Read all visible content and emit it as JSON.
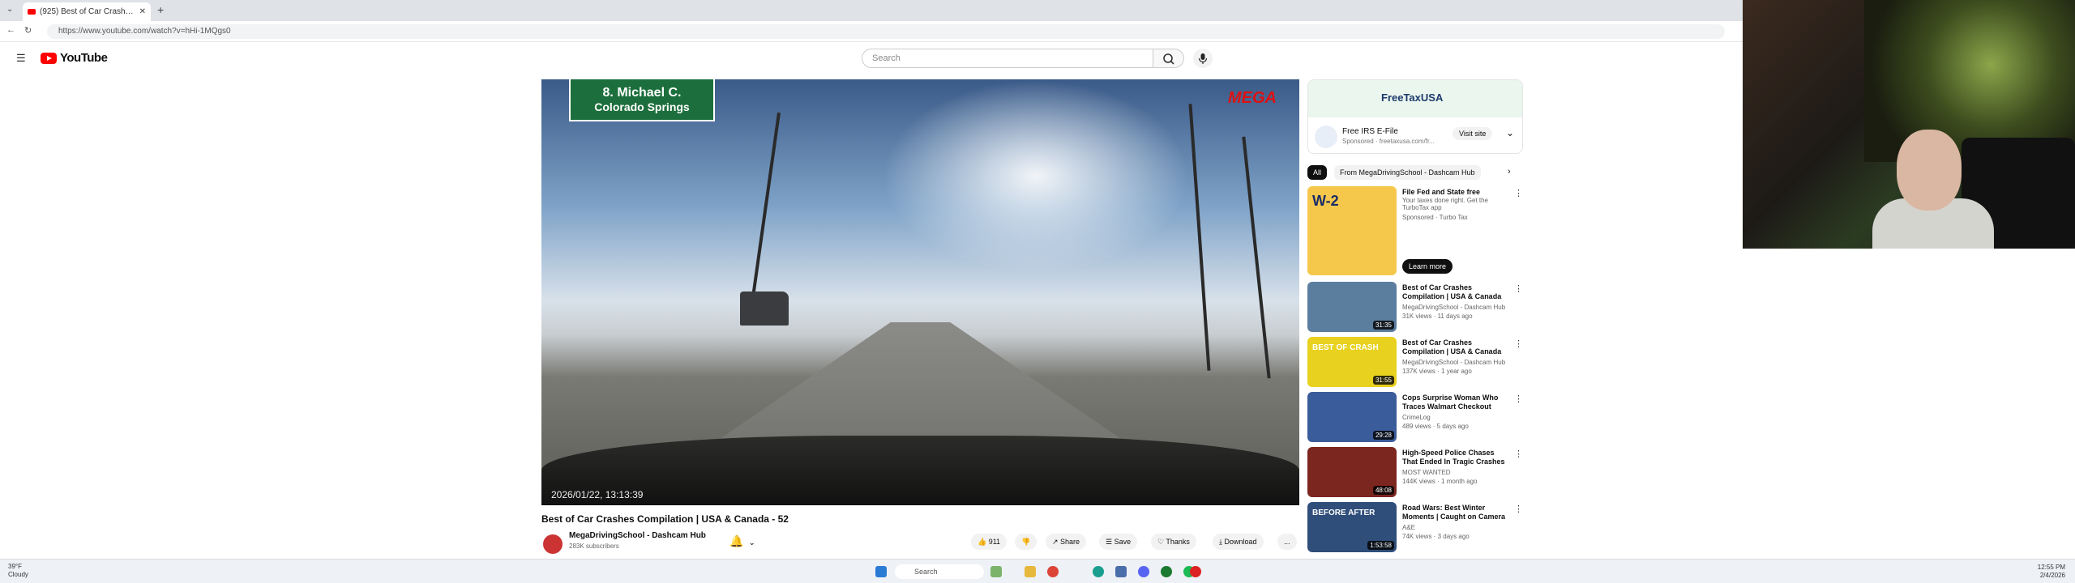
{
  "browser": {
    "tab_title": "(925) Best of Car Crashes Co",
    "url": "https://www.youtube.com/watch?v=hHi-1MQgs0"
  },
  "header": {
    "logo": "YouTube",
    "search_placeholder": "Search"
  },
  "video": {
    "sign_line1": "8. Michael C.",
    "sign_line2": "Colorado Springs",
    "watermark": "MEGA",
    "timestamp": "2026/01/22, 13:13:39",
    "title": "Best of Car Crashes Compilation | USA & Canada - 52",
    "channel": "MegaDrivingSchool - Dashcam Hub",
    "subscribers": "283K subscribers",
    "likes": "911",
    "actions": {
      "share": "Share",
      "save": "Save",
      "thanks": "Thanks",
      "download": "Download",
      "more": "..."
    }
  },
  "ad": {
    "brand": "FreeTaxUSA",
    "title": "Free IRS E-File",
    "sponsor": "Sponsored · freetaxusa.com/fr...",
    "visit": "Visit site"
  },
  "chips": [
    {
      "label": "All",
      "active": true
    },
    {
      "label": "From MegaDrivingSchool - Dashcam Hub",
      "active": false
    }
  ],
  "sidebar": [
    {
      "title": "File Fed and State free",
      "channel": "Your taxes done right. Get the TurboTax app",
      "meta": "Sponsored · Turbo Tax",
      "duration": "",
      "thumb_color": "#f5c84c",
      "thumb_text": "W-2",
      "cta": "Learn more"
    },
    {
      "title": "Best of Car Crashes Compilation | USA & Canada -...",
      "channel": "MegaDrivingSchool - Dashcam Hub",
      "meta": "31K views · 11 days ago",
      "duration": "31:35",
      "thumb_color": "#5b7e9f",
      "thumb_text": "",
      "cta": ""
    },
    {
      "title": "Best of Car Crashes Compilation | USA & Canada -...",
      "channel": "MegaDrivingSchool - Dashcam Hub",
      "meta": "137K views · 1 year ago",
      "duration": "31:55",
      "thumb_color": "#e8d11f",
      "thumb_text": "BEST OF CRASH",
      "cta": ""
    },
    {
      "title": "Cops Surprise Woman Who Traces Walmart Checkout Like...",
      "channel": "CrimeLog",
      "meta": "489 views · 5 days ago",
      "duration": "29:28",
      "thumb_color": "#3b5c9a",
      "thumb_text": "",
      "cta": ""
    },
    {
      "title": "High-Speed Police Chases That Ended In Tragic Crashes",
      "channel": "MOST WANTED",
      "meta": "144K views · 1 month ago",
      "duration": "48:08",
      "thumb_color": "#7c2620",
      "thumb_text": "",
      "cta": ""
    },
    {
      "title": "Road Wars: Best Winter Moments | Caught on Camera ...",
      "channel": "A&E",
      "meta": "74K views · 3 days ago",
      "duration": "1:53:58",
      "thumb_color": "#2f4e7a",
      "thumb_text": "BEFORE AFTER",
      "cta": ""
    }
  ],
  "taskbar": {
    "weather_temp": "39°F",
    "weather_desc": "Cloudy",
    "search": "Search",
    "time": "12:55 PM",
    "date": "2/4/2026"
  }
}
